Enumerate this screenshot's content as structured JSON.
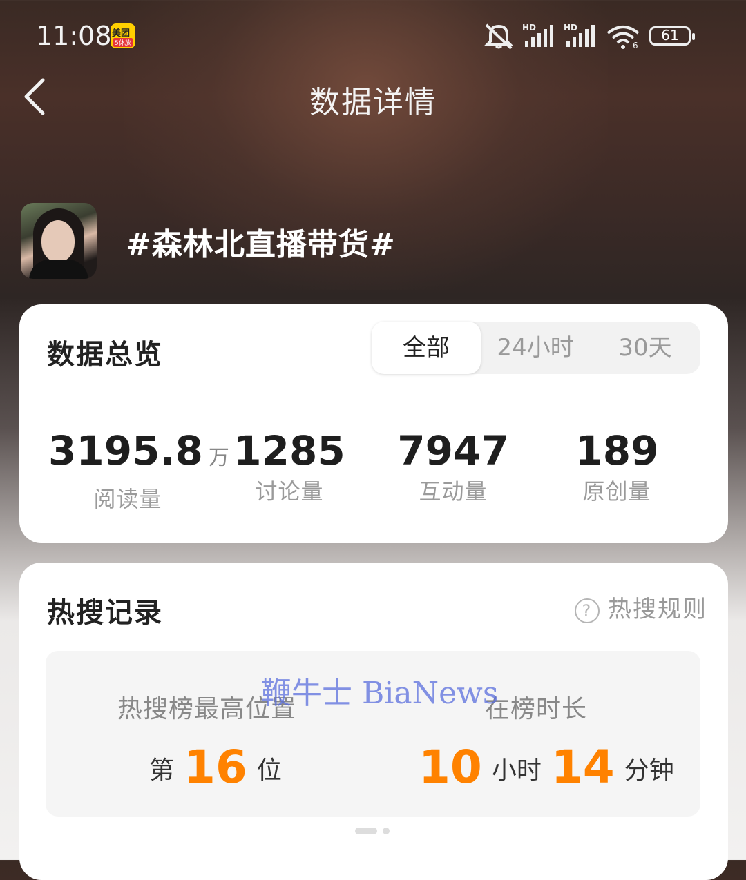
{
  "status_bar": {
    "time": "11:08",
    "meituan_text": "美团",
    "meituan_sub": "5休放",
    "battery": "61"
  },
  "header": {
    "title": "数据详情"
  },
  "topic": {
    "name": "#森林北直播带货#"
  },
  "overview": {
    "title": "数据总览",
    "tabs": [
      {
        "label": "全部",
        "selected": true
      },
      {
        "label": "24小时",
        "selected": false
      },
      {
        "label": "30天",
        "selected": false
      }
    ],
    "stats": [
      {
        "value": "3195.8",
        "unit": "万",
        "label": "阅读量"
      },
      {
        "value": "1285",
        "unit": "",
        "label": "讨论量"
      },
      {
        "value": "7947",
        "unit": "",
        "label": "互动量"
      },
      {
        "value": "189",
        "unit": "",
        "label": "原创量"
      }
    ]
  },
  "hot_search": {
    "title": "热搜记录",
    "rules_label": "热搜规则",
    "rank_label": "热搜榜最高位置",
    "rank_prefix": "第",
    "rank_value": "16",
    "rank_suffix": "位",
    "duration_label": "在榜时长",
    "hours": "10",
    "hours_unit": "小时",
    "minutes": "14",
    "minutes_unit": "分钟"
  },
  "watermark": "鞭牛士 BiaNews",
  "colors": {
    "accent": "#ff8200",
    "watermark": "#5a6edc"
  }
}
